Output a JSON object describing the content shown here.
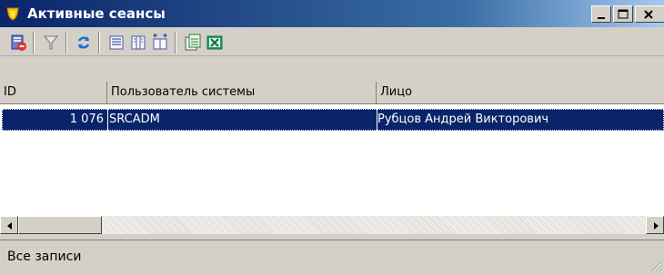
{
  "window": {
    "title": "Активные сеансы",
    "icons": {
      "app": "shield-logo-icon",
      "minimize": "minimize-icon",
      "maximize": "maximize-icon",
      "close": "close-icon"
    }
  },
  "toolbar": {
    "buttons": [
      {
        "name": "export-report-icon"
      },
      {
        "name": "filter-icon"
      },
      {
        "name": "refresh-icon"
      },
      {
        "name": "list-view-icon"
      },
      {
        "name": "columns-icon"
      },
      {
        "name": "fit-columns-icon"
      },
      {
        "name": "copy-icon"
      },
      {
        "name": "excel-icon"
      }
    ]
  },
  "grid": {
    "columns": [
      "ID",
      "Пользователь системы",
      "Лицо"
    ],
    "rows": [
      {
        "id": "1 076",
        "user": "SRCADM",
        "face": "Рубцов Андрей Викторович",
        "selected": true
      }
    ]
  },
  "statusbar": {
    "text": "Все записи"
  },
  "colors": {
    "title_gradient_start": "#0a246a",
    "title_gradient_end": "#a6caf0",
    "selection": "#0a246a",
    "face": "#d4d0c8"
  }
}
